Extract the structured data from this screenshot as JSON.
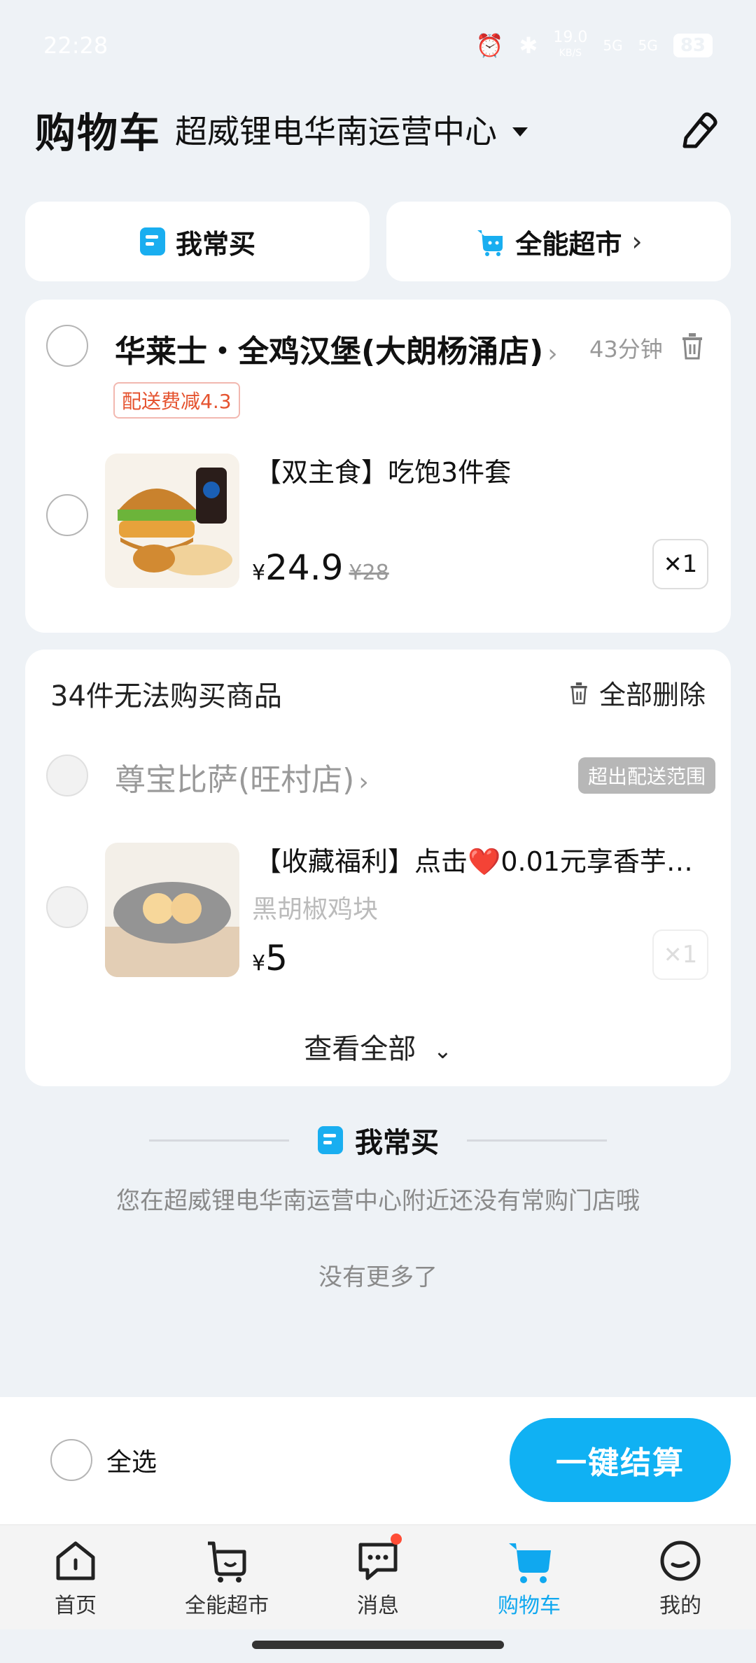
{
  "status_bar": {
    "time": "22:28",
    "net_speed": "19.0",
    "net_unit": "KB/S",
    "signal1": "5G",
    "signal2": "5G",
    "battery": "83"
  },
  "header": {
    "title": "购物车",
    "location": "超威锂电华南运营中心"
  },
  "quick": {
    "frequent_label": "我常买",
    "supermarket_label": "全能超市"
  },
  "store1": {
    "name": "华莱士・全鸡汉堡(大朗杨涌店)",
    "eta": "43分钟",
    "promo": "配送费减4.3",
    "product": {
      "name": "【双主食】吃饱3件套",
      "currency": "¥",
      "price": "24.9",
      "original_price": "¥28",
      "qty": "1"
    }
  },
  "unavailable": {
    "title": "34件无法购买商品",
    "delete_all": "全部删除",
    "store_name": "尊宝比萨(旺村店)",
    "out_of_range": "超出配送范围",
    "product": {
      "name": "【收藏福利】点击❤️0.01元享香芋…",
      "subtitle": "黑胡椒鸡块",
      "currency": "¥",
      "price": "5",
      "qty": "1"
    },
    "view_all": "查看全部"
  },
  "frequent_section": {
    "title": "我常买",
    "desc": "您在超威锂电华南运营中心附近还没有常购门店哦",
    "no_more": "没有更多了"
  },
  "bottom": {
    "select_all": "全选",
    "checkout": "一键结算"
  },
  "tabs": [
    {
      "label": "首页",
      "icon": "home-icon"
    },
    {
      "label": "全能超市",
      "icon": "supermarket-icon"
    },
    {
      "label": "消息",
      "icon": "message-icon"
    },
    {
      "label": "购物车",
      "icon": "cart-icon"
    },
    {
      "label": "我的",
      "icon": "profile-icon"
    }
  ],
  "colors": {
    "accent": "#10b1f3",
    "promo": "#e5532f",
    "background": "#eef2f6"
  }
}
